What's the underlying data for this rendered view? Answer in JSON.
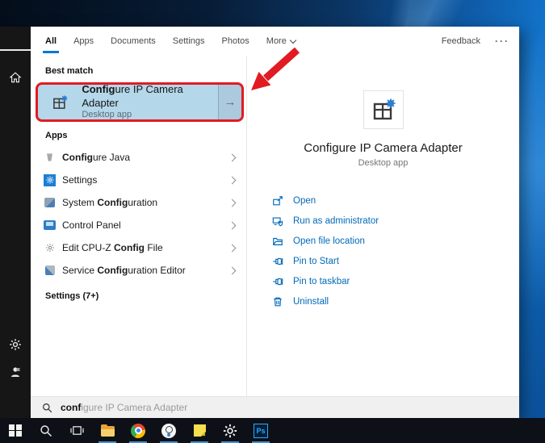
{
  "tabs_bar": {
    "tabs": [
      {
        "label": "All",
        "active": true
      },
      {
        "label": "Apps",
        "active": false
      },
      {
        "label": "Documents",
        "active": false
      },
      {
        "label": "Settings",
        "active": false
      },
      {
        "label": "Photos",
        "active": false
      }
    ],
    "more_label": "More",
    "feedback_label": "Feedback",
    "overflow_label": "···"
  },
  "left_rail": {
    "icons": [
      "hamburger-menu-icon",
      "home-icon",
      "settings-gear-icon",
      "user-account-icon"
    ]
  },
  "results": {
    "best_match": {
      "section_label": "Best match",
      "item": {
        "title_match": "Config",
        "title_rest": "ure IP Camera Adapter",
        "subtitle": "Desktop app",
        "icon": "app-default-icon",
        "arrow_glyph": "→"
      }
    },
    "apps": {
      "label": "Apps",
      "items": [
        {
          "pre": "",
          "match": "Config",
          "post": "ure Java",
          "icon": "java-icon"
        },
        {
          "pre": "Settings",
          "match": "",
          "post": "",
          "icon": "settings-icon"
        },
        {
          "pre": "System ",
          "match": "Config",
          "post": "uration",
          "icon": "system-configuration-icon"
        },
        {
          "pre": "Control Panel",
          "match": "",
          "post": "",
          "icon": "control-panel-icon"
        },
        {
          "pre": "Edit CPU-Z ",
          "match": "Config",
          "post": " File",
          "icon": "config-file-icon"
        },
        {
          "pre": "Service ",
          "match": "Config",
          "post": "uration Editor",
          "icon": "service-configuration-icon"
        }
      ]
    },
    "settings_label": "Settings (7+)"
  },
  "details": {
    "title": "Configure IP Camera Adapter",
    "subtitle": "Desktop app",
    "icon": "app-default-icon",
    "actions": [
      {
        "label": "Open",
        "icon": "open-icon"
      },
      {
        "label": "Run as administrator",
        "icon": "run-as-administrator-icon"
      },
      {
        "label": "Open file location",
        "icon": "open-file-location-icon"
      },
      {
        "label": "Pin to Start",
        "icon": "pin-icon"
      },
      {
        "label": "Pin to taskbar",
        "icon": "pin-icon"
      },
      {
        "label": "Uninstall",
        "icon": "uninstall-icon"
      }
    ]
  },
  "search_box": {
    "typed": "conf",
    "suggestion": "igure IP Camera Adapter",
    "icon": "search-icon"
  },
  "taskbar": {
    "items": [
      {
        "name": "start-button",
        "running": false
      },
      {
        "name": "search-button",
        "running": false
      },
      {
        "name": "task-view-button",
        "running": false
      },
      {
        "name": "file-explorer-button",
        "running": true
      },
      {
        "name": "chrome-button",
        "running": true
      },
      {
        "name": "camera-app-button",
        "running": true
      },
      {
        "name": "sticky-notes-button",
        "running": true
      },
      {
        "name": "settings-button",
        "running": true
      },
      {
        "name": "photoshop-button",
        "running": true,
        "label": "Ps"
      }
    ]
  },
  "annotation": {
    "type": "red-box-and-arrow",
    "color": "#e11b22"
  },
  "colors": {
    "accent": "#0078d7",
    "link_blue": "#0069b9",
    "best_match_bg": "#b5d7ea",
    "annotation_red": "#e11b22",
    "rail_bg": "#161616",
    "taskbar_bg": "#0d1117"
  }
}
